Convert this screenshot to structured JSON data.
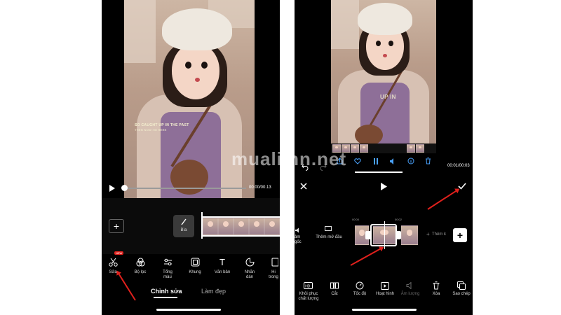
{
  "watermark": "mualimn.net",
  "left": {
    "video": {
      "caption_line1": "SO CAUGHT UP IN THE PAST",
      "caption_line2": "THEN NOW I'M HERE",
      "time": "00.00/00.13"
    },
    "timeline": {
      "add_label": "+",
      "audio_label": "Bìa"
    },
    "tools": [
      {
        "label": "Sửa",
        "icon": "scissors-icon",
        "badge": "NEW"
      },
      {
        "label": "Bộ lọc",
        "icon": "filter-icon"
      },
      {
        "label": "Tổng màu",
        "icon": "adjust-icon"
      },
      {
        "label": "Khung",
        "icon": "frame-icon"
      },
      {
        "label": "Văn bản",
        "icon": "text-icon"
      },
      {
        "label": "Nhãn dán",
        "icon": "sticker-icon"
      },
      {
        "label": "Hi trong",
        "icon": "overlay-icon"
      }
    ],
    "tabs": {
      "active": "Chỉnh sửa",
      "other": "Làm đẹp"
    }
  },
  "right": {
    "video": {
      "caption": "UP IN",
      "time": "00:01/00:03"
    },
    "editor": {
      "ruler_0": "00:00",
      "ruler_1": "00:02",
      "original_audio": "âm gốc",
      "original_audio_line1": "âm",
      "original_audio_line2": "gốc",
      "add_opening": "Thêm mở đầu",
      "add_more": "Thêm k",
      "add_button": "+"
    },
    "tools": [
      {
        "label": "Khôi phục chất lượng",
        "icon": "hd-icon"
      },
      {
        "label": "Cắt",
        "icon": "split-icon"
      },
      {
        "label": "Tốc độ",
        "icon": "speed-icon"
      },
      {
        "label": "Hoạt hình",
        "icon": "animation-icon"
      },
      {
        "label": "Âm lượng",
        "icon": "volume-icon"
      },
      {
        "label": "Xóa",
        "icon": "trash-icon"
      },
      {
        "label": "Sao chép",
        "icon": "copy-icon"
      }
    ]
  }
}
